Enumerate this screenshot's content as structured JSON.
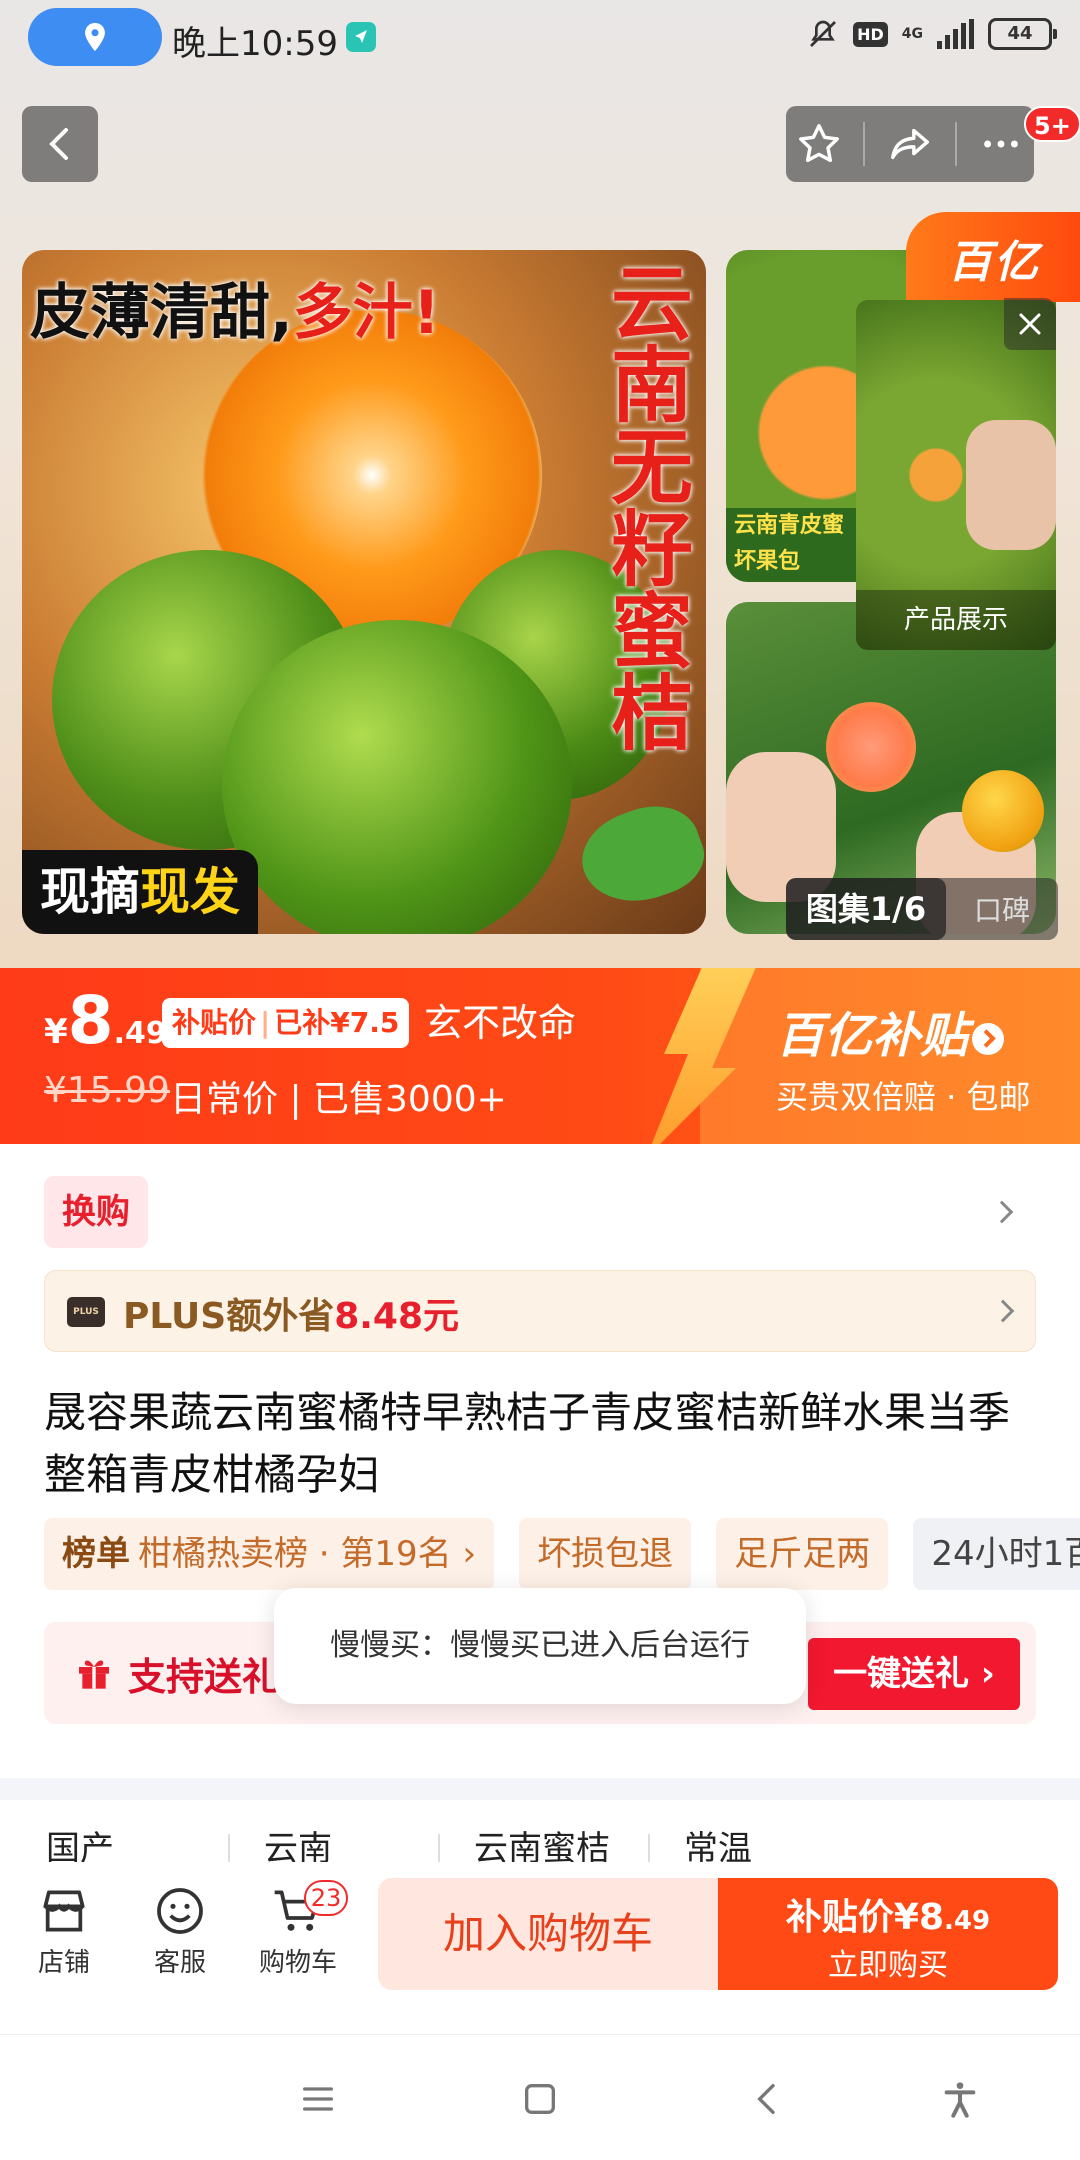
{
  "status_bar": {
    "time": "晚上10:59",
    "hd": "HD",
    "network": "4G",
    "battery": "44"
  },
  "header": {
    "message_badge": "5+"
  },
  "gallery": {
    "headline_black": "皮薄清甜,",
    "headline_red": "多汁!",
    "vertical_title": "云南无籽蜜桔",
    "tag_white": "现摘",
    "tag_yellow": "现发",
    "thumb_ribbon_line1": "云南青皮蜜",
    "thumb_ribbon_line2": "坏果包",
    "gallery_count": "图集1/6",
    "reviews_tab": "口碑",
    "brand_corner": "百亿",
    "float_video_caption": "产品展示"
  },
  "price_banner": {
    "currency": "¥",
    "price_int": "8",
    "price_dec": ".49",
    "subsidy_label": "补贴价",
    "subsidy_amount": "已补¥7.5",
    "seller": "玄不改命",
    "old_price": "¥15.99",
    "daily_text": "日常价 | 已售3000+",
    "brand_title": "百亿补贴",
    "brand_sub": "买贵双倍赔 · 包邮"
  },
  "exchange": {
    "label": "换购"
  },
  "plus": {
    "logo": "PLUS",
    "text_main": "PLUS额外省",
    "text_amount": "8.48元"
  },
  "product": {
    "title": "晟容果蔬云南蜜橘特早熟桔子青皮蜜桔新鲜水果当季整箱青皮柑橘孕妇"
  },
  "tags": [
    {
      "bold": "榜单",
      "text": "柑橘热卖榜 · 第19名 ›"
    },
    {
      "text": "坏损包退"
    },
    {
      "text": "足斤足两"
    },
    {
      "text": "24小时1百"
    }
  ],
  "gift": {
    "text": "支持送礼物",
    "button": "一键送礼 ›"
  },
  "toast": {
    "text": "慢慢买：慢慢买已进入后台运行"
  },
  "specs": [
    "国产",
    "云南",
    "云南蜜桔",
    "常温"
  ],
  "action_bar": {
    "store": "店铺",
    "service": "客服",
    "cart": "购物车",
    "cart_count": "23",
    "add_to_cart": "加入购物车",
    "buy_price_label": "补贴价¥",
    "buy_price_int": "8",
    "buy_price_dec": ".49",
    "buy_now": "立即购买"
  },
  "colors": {
    "accent": "#ff4a15",
    "red": "#e8202e",
    "status_pill": "#3d8df2"
  }
}
